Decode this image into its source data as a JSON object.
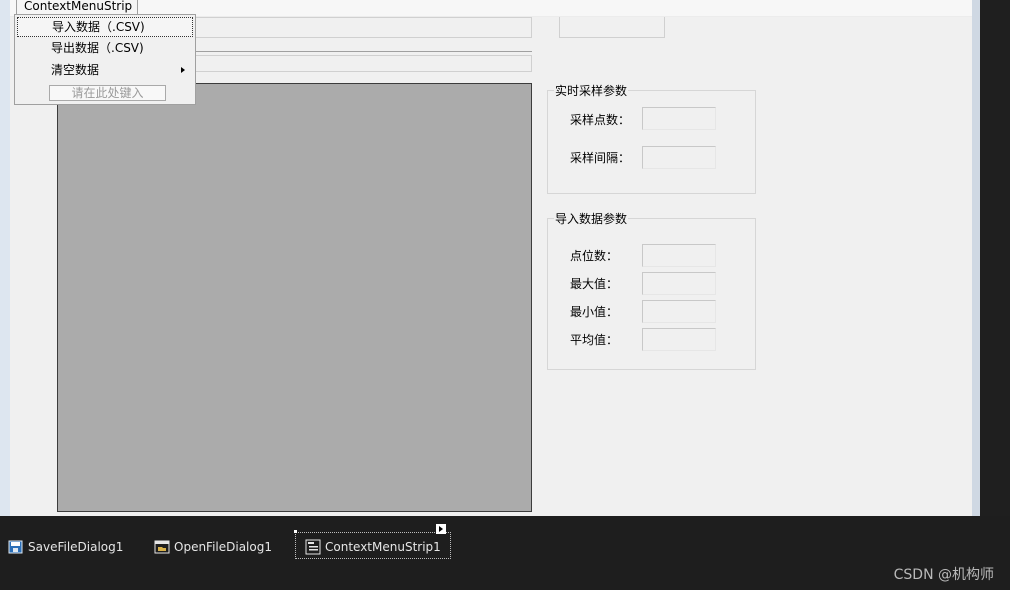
{
  "context_menu": {
    "tab_label": "ContextMenuStrip",
    "items": [
      {
        "label": "导入数据（.CSV)"
      },
      {
        "label": "导出数据（.CSV)"
      },
      {
        "label": "清空数据"
      }
    ],
    "entry_placeholder": "请在此处键入"
  },
  "realtime_group": {
    "title": "实时采样参数",
    "labels": [
      "采样点数：",
      "采样间隔："
    ]
  },
  "import_group": {
    "title": "导入数据参数",
    "labels": [
      "点位数：",
      "最大值：",
      "最小值：",
      "平均值："
    ]
  },
  "tray": {
    "items": [
      "SaveFileDialog1",
      "OpenFileDialog1",
      "ContextMenuStrip1"
    ]
  },
  "watermark": "CSDN @机构师"
}
